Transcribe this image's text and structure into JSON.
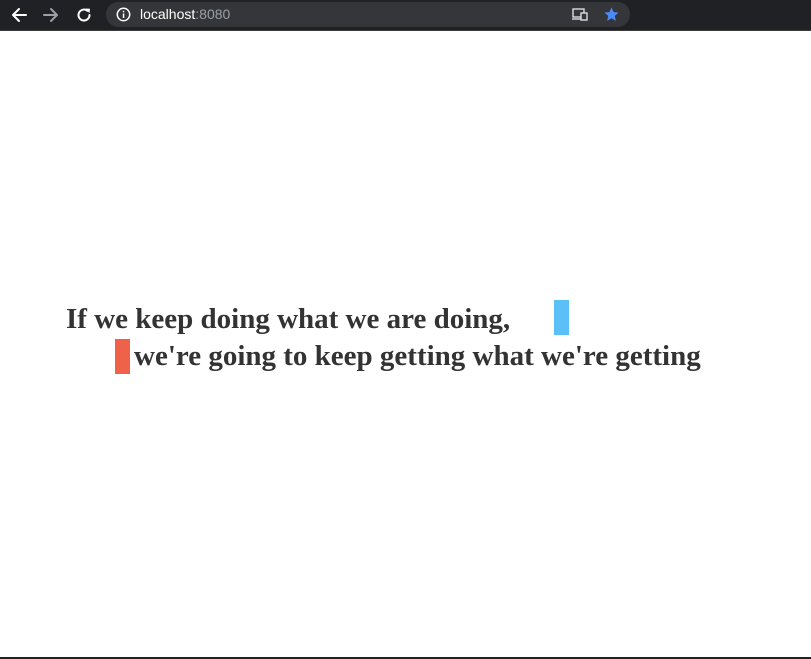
{
  "browser": {
    "url_host": "localhost",
    "url_port": ":8080",
    "icons": {
      "back": "arrow-left-icon",
      "forward": "arrow-right-icon",
      "reload": "reload-icon",
      "site_info": "info-icon",
      "cast": "cast-icon",
      "bookmark": "star-icon"
    },
    "colors": {
      "toolbar": "#202124",
      "omnibox": "#35363a",
      "bookmark_star": "#4c8bf5"
    }
  },
  "content": {
    "line_1": "If we keep doing what we are doing,",
    "line_2": "we're going to keep getting what we're getting",
    "colors": {
      "text": "#333333",
      "marker_blue": "#5bc0f8",
      "marker_red": "#f0614a"
    }
  }
}
